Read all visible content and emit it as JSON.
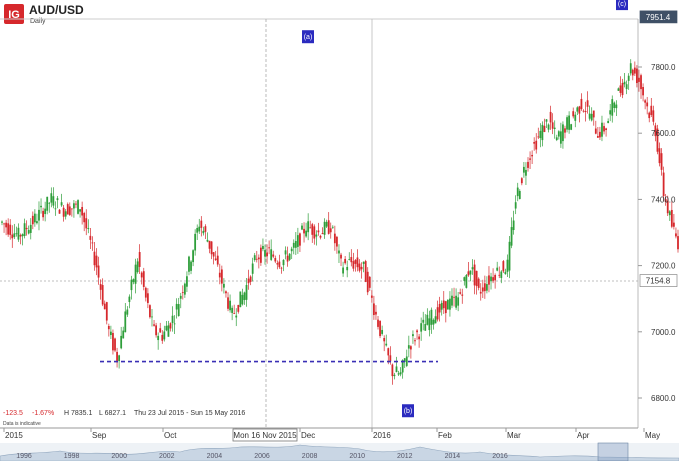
{
  "chart_data": {
    "type": "candlestick",
    "title": "AUD/USD",
    "subtitle": "Daily",
    "brand_logo": "IG",
    "ylim": [
      6780,
      7990
    ],
    "y_ticks": [
      "7800.0",
      "7600.0",
      "7400.0",
      "7200.0",
      "7000.0",
      "6800.0"
    ],
    "y_tick_values": [
      7800,
      7600,
      7400,
      7200,
      7000,
      6800
    ],
    "x_ticks": [
      "2015",
      "Sep",
      "Oct",
      "Nov",
      "Dec",
      "2016",
      "Feb",
      "Mar",
      "Apr",
      "May"
    ],
    "crosshair_label": "Mon 16 Nov 2015",
    "price_labels": [
      {
        "value": 7951.4,
        "text": "7951.4",
        "style": "dark"
      },
      {
        "value": 7154.8,
        "text": "7154.8",
        "style": "light"
      }
    ],
    "annotations": [
      {
        "label": "(a)",
        "value": 7890
      },
      {
        "label": "(b)",
        "value": 6760
      },
      {
        "label": "(c)",
        "value": 7990
      }
    ],
    "support_line": {
      "value": 6910,
      "color": "#3a2fb5"
    },
    "stats": {
      "change": "-123.5",
      "change_pct": "-1.67%",
      "high": "H 7835.1",
      "low": "L 6827.1",
      "range": "Thu 23 Jul 2015 - Sun 15 May 2016"
    },
    "disclaimer": "Data is indicative",
    "navigator_years": [
      "1996",
      "1998",
      "2000",
      "2002",
      "2004",
      "2006",
      "2008",
      "2010",
      "2012",
      "2014",
      "2016"
    ],
    "colors": {
      "up": "#2e9e3a",
      "down": "#d6282c",
      "annotation": "#2b2bbf",
      "axis_dark": "#3f5066"
    },
    "path_anchors": [
      [
        0,
        7330
      ],
      [
        8,
        7290
      ],
      [
        16,
        7340
      ],
      [
        24,
        7400
      ],
      [
        30,
        7370
      ],
      [
        38,
        7380
      ],
      [
        46,
        7200
      ],
      [
        52,
        7000
      ],
      [
        56,
        6920
      ],
      [
        60,
        7050
      ],
      [
        66,
        7220
      ],
      [
        70,
        7100
      ],
      [
        74,
        7000
      ],
      [
        78,
        6990
      ],
      [
        84,
        7050
      ],
      [
        90,
        7180
      ],
      [
        96,
        7330
      ],
      [
        100,
        7280
      ],
      [
        106,
        7170
      ],
      [
        112,
        7050
      ],
      [
        118,
        7120
      ],
      [
        124,
        7230
      ],
      [
        130,
        7240
      ],
      [
        136,
        7210
      ],
      [
        142,
        7250
      ],
      [
        148,
        7320
      ],
      [
        154,
        7300
      ],
      [
        160,
        7320
      ],
      [
        165,
        7200
      ],
      [
        170,
        7210
      ],
      [
        176,
        7190
      ],
      [
        182,
        7050
      ],
      [
        186,
        6960
      ],
      [
        190,
        6880
      ],
      [
        194,
        6870
      ],
      [
        198,
        6960
      ],
      [
        204,
        7010
      ],
      [
        210,
        7050
      ],
      [
        216,
        7080
      ],
      [
        222,
        7100
      ],
      [
        228,
        7200
      ],
      [
        232,
        7120
      ],
      [
        236,
        7150
      ],
      [
        240,
        7180
      ],
      [
        246,
        7200
      ],
      [
        250,
        7400
      ],
      [
        254,
        7490
      ],
      [
        258,
        7550
      ],
      [
        262,
        7600
      ],
      [
        266,
        7640
      ],
      [
        270,
        7580
      ],
      [
        274,
        7620
      ],
      [
        278,
        7650
      ],
      [
        282,
        7690
      ],
      [
        286,
        7660
      ],
      [
        290,
        7600
      ],
      [
        294,
        7620
      ],
      [
        298,
        7700
      ],
      [
        302,
        7740
      ],
      [
        306,
        7800
      ],
      [
        310,
        7760
      ],
      [
        314,
        7680
      ],
      [
        318,
        7610
      ],
      [
        322,
        7420
      ],
      [
        326,
        7320
      ],
      [
        329,
        7270
      ]
    ]
  }
}
